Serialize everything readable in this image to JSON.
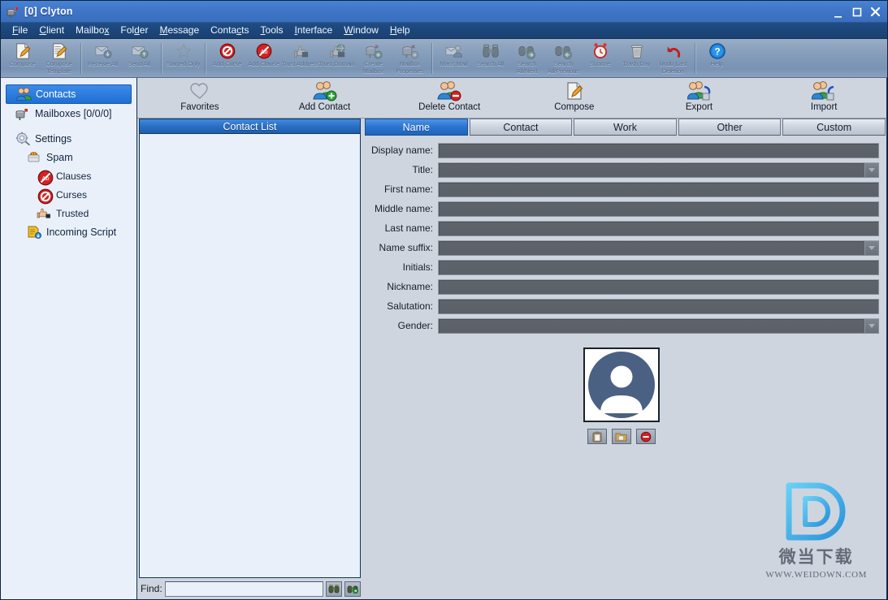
{
  "window": {
    "title": "[0] Clyton",
    "icon": "mailbox-icon",
    "minimize_label": "–",
    "maximize_label": "□",
    "close_label": "✕"
  },
  "menubar": {
    "items": [
      {
        "label": "File",
        "accel": "F"
      },
      {
        "label": "Client",
        "accel": "C"
      },
      {
        "label": "Mailbox",
        "accel": "x"
      },
      {
        "label": "Folder",
        "accel": "d"
      },
      {
        "label": "Message",
        "accel": "M"
      },
      {
        "label": "Contacts",
        "accel": "c"
      },
      {
        "label": "Tools",
        "accel": "T"
      },
      {
        "label": "Interface",
        "accel": "I"
      },
      {
        "label": "Window",
        "accel": "W"
      },
      {
        "label": "Help",
        "accel": "H"
      }
    ]
  },
  "toolbar": {
    "buttons": [
      {
        "label": "Compose",
        "icon": "compose-page-pencil-icon",
        "disabled": false
      },
      {
        "label": "Compose Template",
        "icon": "compose-template-icon",
        "disabled": false
      },
      {
        "sep": true
      },
      {
        "label": "Receive All",
        "icon": "receive-mail-icon",
        "disabled": true
      },
      {
        "label": "Send All",
        "icon": "send-mail-icon",
        "disabled": true
      },
      {
        "sep": true
      },
      {
        "label": "Starred Only",
        "icon": "star-outline-icon",
        "disabled": true
      },
      {
        "sep": true
      },
      {
        "label": "Add Curse",
        "icon": "curse-deny-icon",
        "disabled": false
      },
      {
        "label": "Add Clause",
        "icon": "clause-deny-icon",
        "disabled": false
      },
      {
        "label": "Trust Address",
        "icon": "thumbs-up-address-icon",
        "disabled": true
      },
      {
        "label": "Trust Domain",
        "icon": "thumbs-up-globe-icon",
        "disabled": true
      },
      {
        "label": "Create Mailbox",
        "icon": "mailbox-add-icon",
        "disabled": true
      },
      {
        "label": "Mailbox Properties",
        "icon": "mailbox-gear-icon",
        "disabled": true
      },
      {
        "sep": true
      },
      {
        "label": "Mass Mail",
        "icon": "mass-mail-people-icon",
        "disabled": true
      },
      {
        "label": "Search All",
        "icon": "binoculars-icon",
        "disabled": true
      },
      {
        "label": "Search All/Next",
        "icon": "binoculars-next-icon",
        "disabled": true
      },
      {
        "label": "Search All/Previous",
        "icon": "binoculars-previous-icon",
        "disabled": true
      },
      {
        "label": "Snooze",
        "icon": "alarm-clock-icon",
        "disabled": false
      },
      {
        "label": "Trash Day",
        "icon": "trash-can-icon",
        "disabled": false
      },
      {
        "label": "Undo Last Deletion",
        "icon": "undo-arrow-icon",
        "disabled": false
      },
      {
        "sep": true
      },
      {
        "label": "Help",
        "icon": "question-help-icon",
        "disabled": false
      }
    ]
  },
  "sidebar": {
    "items": [
      {
        "label": "Contacts",
        "icon": "contacts-people-icon",
        "level": 0,
        "selected": true
      },
      {
        "label": "Mailboxes [0/0/0]",
        "icon": "mailbox-icon",
        "level": 0,
        "selected": false
      },
      {
        "gap": true
      },
      {
        "label": "Settings",
        "icon": "settings-gear-icon",
        "level": 0,
        "selected": false
      },
      {
        "label": "Spam",
        "icon": "spam-can-icon",
        "level": 1,
        "selected": false
      },
      {
        "label": "Clauses",
        "icon": "clause-deny-icon",
        "level": 2,
        "selected": false
      },
      {
        "label": "Curses",
        "icon": "curse-deny-icon",
        "level": 2,
        "selected": false
      },
      {
        "label": "Trusted",
        "icon": "thumbs-up-icon",
        "level": 2,
        "selected": false
      },
      {
        "label": "Incoming Script",
        "icon": "script-icon",
        "level": 1,
        "selected": false
      }
    ]
  },
  "subtoolbar": {
    "buttons": [
      {
        "label": "Favorites",
        "icon": "heart-outline-icon"
      },
      {
        "label": "Add Contact",
        "icon": "contact-add-icon"
      },
      {
        "label": "Delete Contact",
        "icon": "contact-delete-icon"
      },
      {
        "label": "Compose",
        "icon": "compose-page-pencil-icon"
      },
      {
        "label": "Export",
        "icon": "contact-export-icon"
      },
      {
        "label": "Import",
        "icon": "contact-import-icon"
      }
    ]
  },
  "contact_list": {
    "header": "Contact List",
    "items": [],
    "find": {
      "label": "Find:",
      "value": "",
      "placeholder": "",
      "search_button": "binoculars-icon",
      "search_next_button": "binoculars-next-icon"
    }
  },
  "tabs": [
    {
      "label": "Name",
      "active": true
    },
    {
      "label": "Contact",
      "active": false
    },
    {
      "label": "Work",
      "active": false
    },
    {
      "label": "Other",
      "active": false
    },
    {
      "label": "Custom",
      "active": false
    }
  ],
  "form": {
    "fields": [
      {
        "label": "Display name:",
        "value": "",
        "type": "text",
        "disabled": true
      },
      {
        "label": "Title:",
        "value": "",
        "type": "combo",
        "disabled": true
      },
      {
        "label": "First name:",
        "value": "",
        "type": "text",
        "disabled": true
      },
      {
        "label": "Middle name:",
        "value": "",
        "type": "text",
        "disabled": true
      },
      {
        "label": "Last name:",
        "value": "",
        "type": "text",
        "disabled": true
      },
      {
        "label": "Name suffix:",
        "value": "",
        "type": "combo",
        "disabled": true
      },
      {
        "label": "Initials:",
        "value": "",
        "type": "text",
        "disabled": true
      },
      {
        "label": "Nickname:",
        "value": "",
        "type": "text",
        "disabled": true
      },
      {
        "label": "Salutation:",
        "value": "",
        "type": "text",
        "disabled": true
      },
      {
        "label": "Gender:",
        "value": "",
        "type": "combo",
        "disabled": true
      }
    ],
    "avatar": {
      "icon": "default-person-avatar-icon",
      "buttons": [
        {
          "icon": "paste-clipboard-icon"
        },
        {
          "icon": "open-folder-icon"
        },
        {
          "icon": "remove-deny-icon"
        }
      ]
    }
  },
  "watermark": {
    "logo": "letter-d-logo",
    "text_cn": "微当下载",
    "url": "WWW.WEIDOWN.COM"
  },
  "colors": {
    "accent_blue": "#2a6fc4",
    "titlebar_blue": "#3f76c8",
    "panel_gray": "#ced5df",
    "sidebar_bg": "#eaf0fa",
    "disabled_field": "#5f646c",
    "watermark_blue": "#3cb3ef"
  }
}
